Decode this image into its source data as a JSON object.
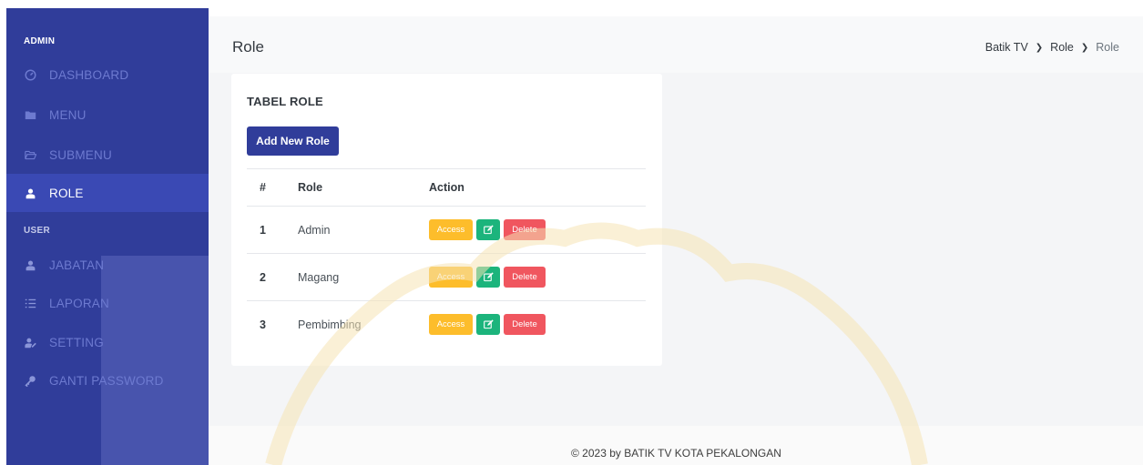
{
  "sidebar": {
    "admin_heading": "ADMIN",
    "user_heading": "USER",
    "items": [
      {
        "label": "DASHBOARD",
        "icon": "dashboard-icon"
      },
      {
        "label": "MENU",
        "icon": "folder-icon"
      },
      {
        "label": "SUBMENU",
        "icon": "folder-open-icon"
      },
      {
        "label": "ROLE",
        "icon": "user-icon",
        "active": true
      },
      {
        "label": "JABATAN",
        "icon": "user-icon"
      },
      {
        "label": "LAPORAN",
        "icon": "list-icon"
      },
      {
        "label": "SETTING",
        "icon": "user-cog-icon"
      },
      {
        "label": "GANTI PASSWORD",
        "icon": "key-icon"
      }
    ]
  },
  "header": {
    "title": "Role",
    "breadcrumb": [
      "Batik TV",
      "Role",
      "Role"
    ]
  },
  "card": {
    "title": "TABEL ROLE",
    "add_button": "Add New Role",
    "columns": [
      "#",
      "Role",
      "Action"
    ],
    "rows": [
      {
        "num": "1",
        "role": "Admin"
      },
      {
        "num": "2",
        "role": "Magang"
      },
      {
        "num": "3",
        "role": "Pembimbing"
      }
    ],
    "actions": {
      "access": "Access",
      "delete": "Delete"
    }
  },
  "footer": {
    "text": "© 2023 by BATIK TV KOTA PEKALONGAN"
  },
  "colors": {
    "sidebar": "#303d9a",
    "sidebar_active": "#3a49b4",
    "primary": "#303d9a",
    "access": "#fdbd2b",
    "edit": "#1cb47c",
    "delete": "#f0565f"
  }
}
